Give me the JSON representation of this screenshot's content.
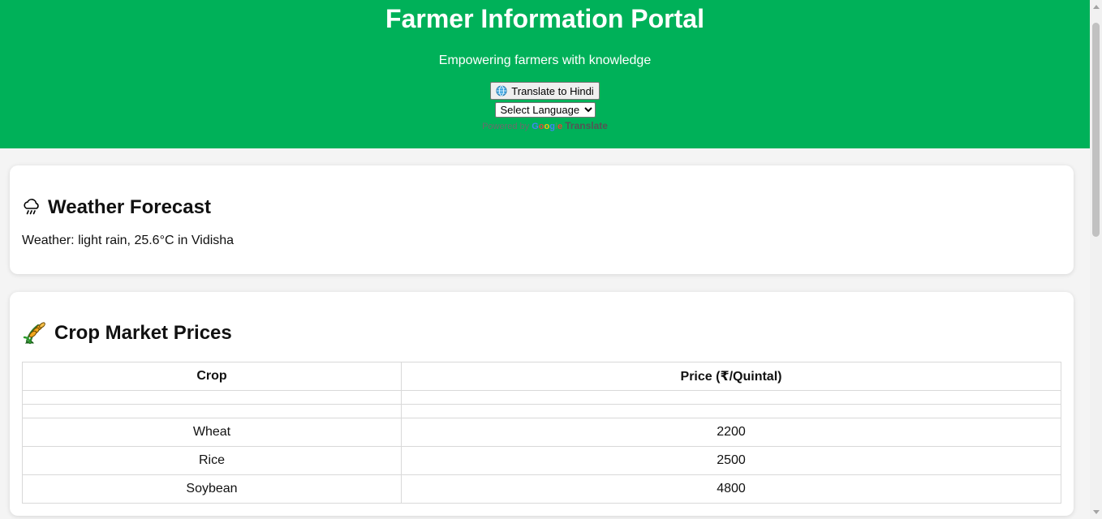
{
  "header": {
    "title": "Farmer Information Portal",
    "subtitle": "Empowering farmers with knowledge",
    "translate_button_label": "Translate to Hindi",
    "language_select_value": "Select Language",
    "powered_by_prefix": "Powered by",
    "google_letters": [
      "G",
      "o",
      "o",
      "g",
      "l",
      "e"
    ],
    "google_colors": [
      "#4285f4",
      "#ea4335",
      "#fbbc05",
      "#4285f4",
      "#34a853",
      "#ea4335"
    ],
    "translate_link": "Translate",
    "accent_color": "#00b159"
  },
  "weather": {
    "icon": "cloud-rain-icon",
    "heading": "Weather Forecast",
    "text": "Weather: light rain, 25.6°C in Vidisha"
  },
  "crops": {
    "icon": "sheaf-of-rice-icon",
    "heading": "Crop Market Prices",
    "columns": [
      "Crop",
      "Price (₹/Quintal)"
    ],
    "rows": [
      [
        "Wheat",
        "2200"
      ],
      [
        "Rice",
        "2500"
      ],
      [
        "Soybean",
        "4800"
      ]
    ]
  }
}
